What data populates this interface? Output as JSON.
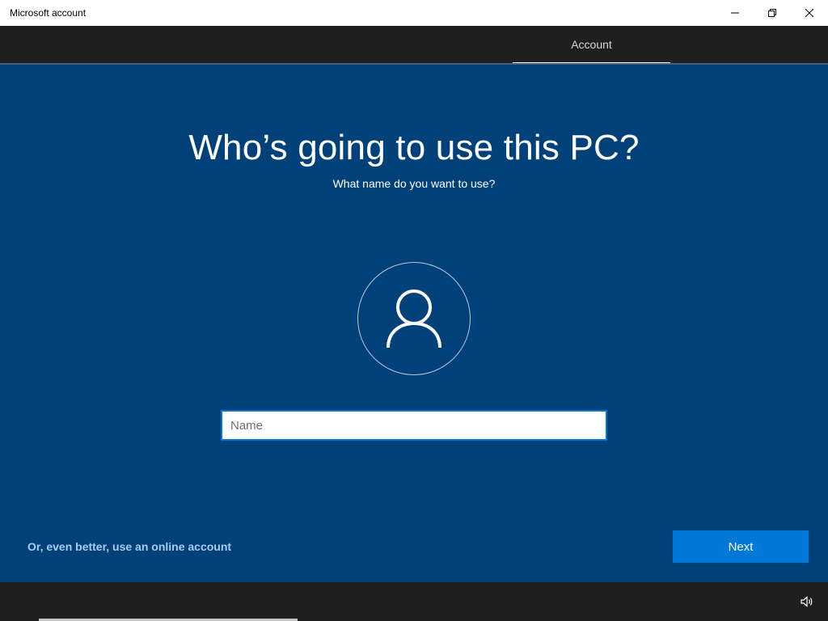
{
  "window": {
    "title": "Microsoft account"
  },
  "header": {
    "tab_label": "Account"
  },
  "main": {
    "heading": "Who’s going to use this PC?",
    "subheading": "What name do you want to use?",
    "avatar_icon": "user-icon",
    "name_field": {
      "placeholder": "Name",
      "value": ""
    },
    "online_account_link": "Or, even better, use an online account",
    "next_button": "Next"
  },
  "footer": {
    "volume_icon": "volume-icon"
  },
  "colors": {
    "background": "#004179",
    "header_bg": "#1f1f1f",
    "accent": "#0078d7",
    "link": "#a9ccf0"
  }
}
